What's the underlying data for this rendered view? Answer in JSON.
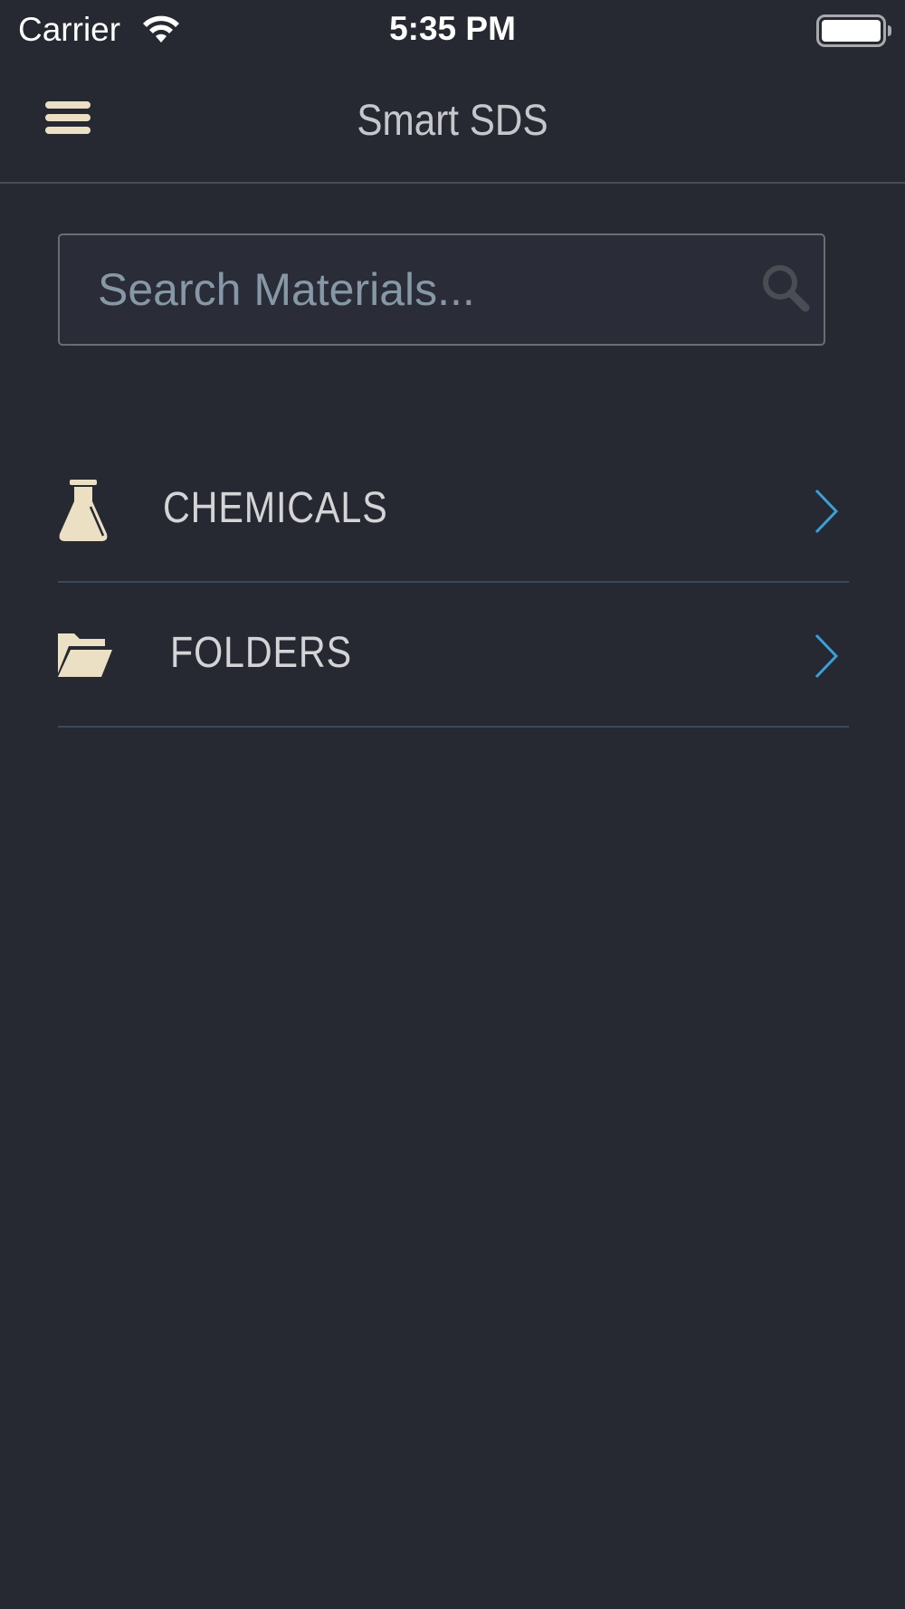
{
  "status_bar": {
    "carrier": "Carrier",
    "time": "5:35 PM"
  },
  "nav": {
    "title": "Smart SDS",
    "menu_icon": "hamburger-menu-icon"
  },
  "search": {
    "placeholder": "Search Materials...",
    "value": "",
    "icon": "search-icon"
  },
  "list": {
    "items": [
      {
        "label": "CHEMICALS",
        "icon": "flask-icon"
      },
      {
        "label": "FOLDERS",
        "icon": "folder-icon"
      }
    ]
  },
  "colors": {
    "background": "#262932",
    "accent_icon": "#ece0c4",
    "chevron": "#3aa0dc",
    "divider": "#3a4a5a",
    "placeholder": "#8698a5"
  }
}
